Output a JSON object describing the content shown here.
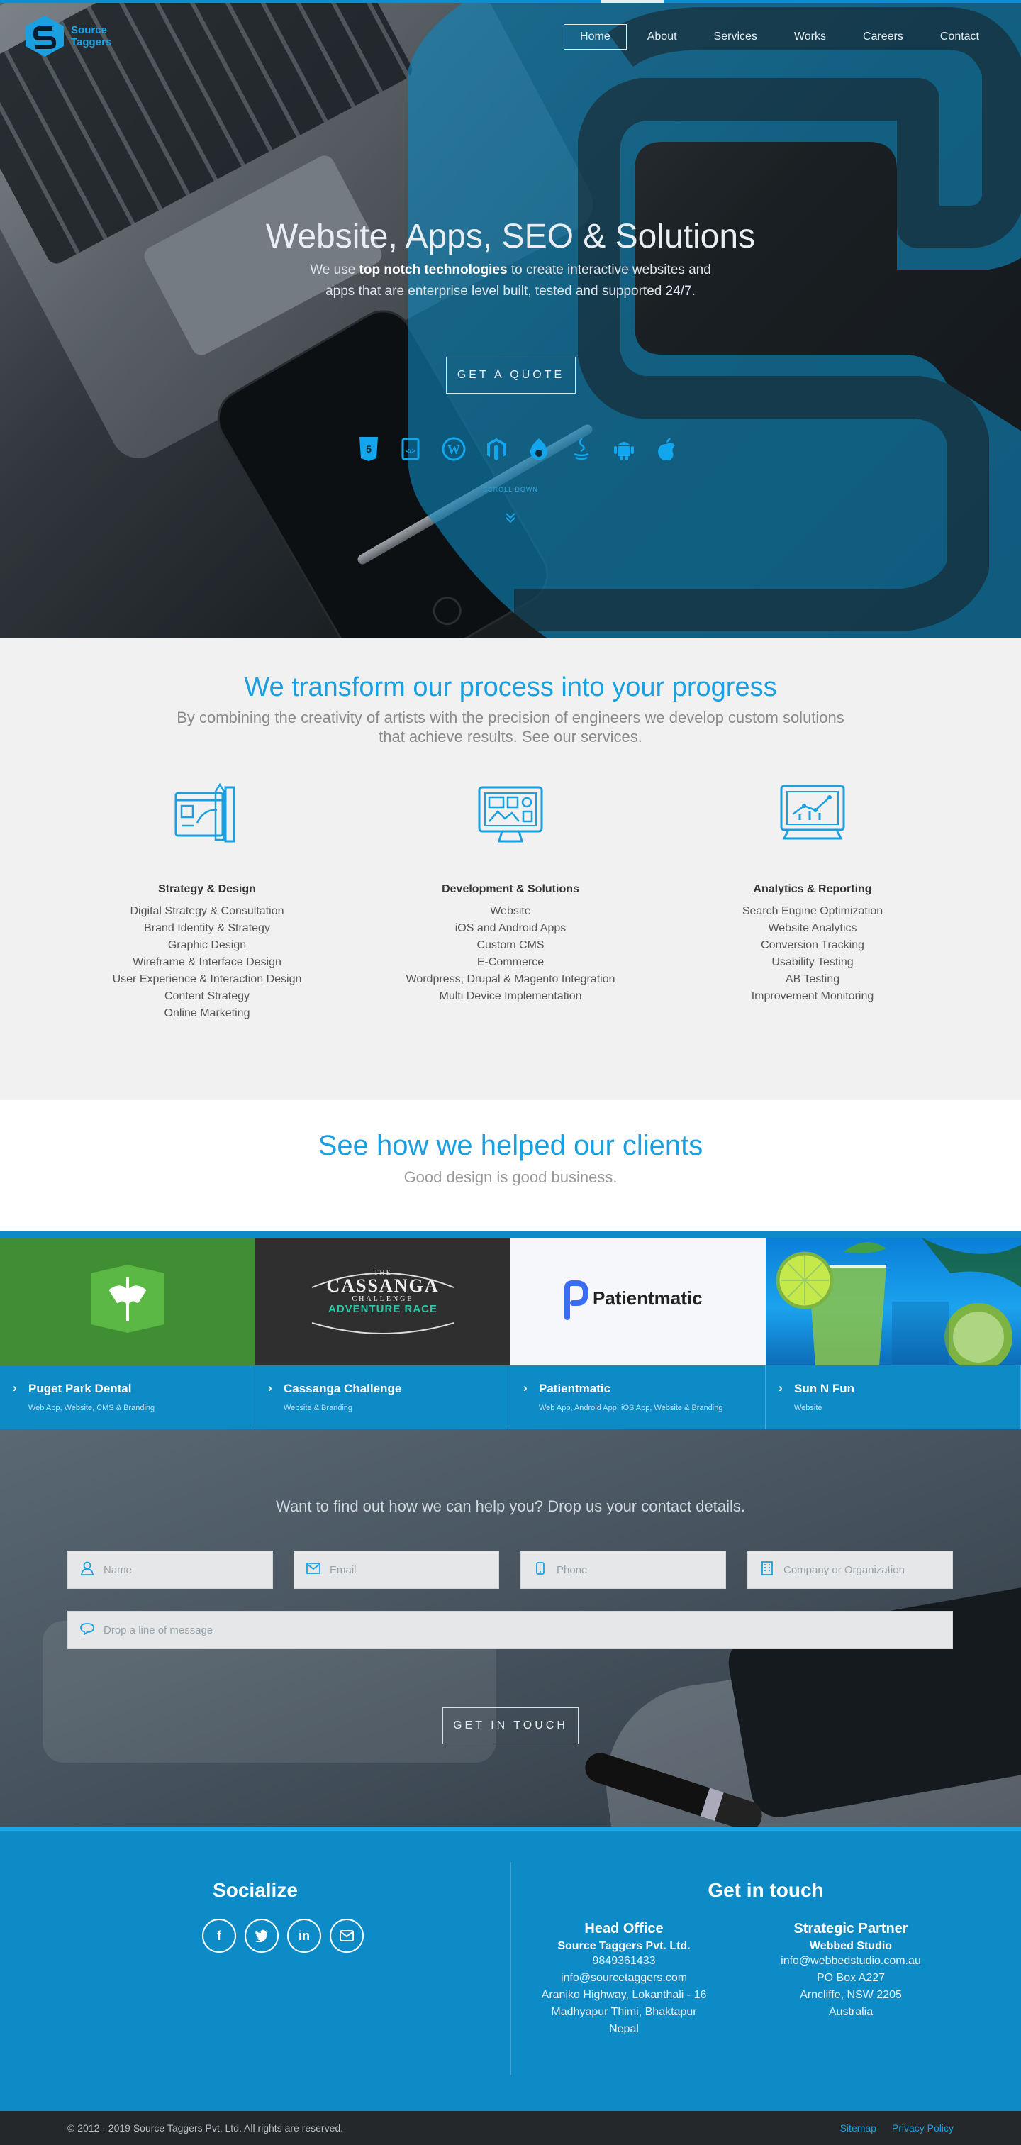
{
  "brand": {
    "name_line1": "Source",
    "name_line2": "Taggers",
    "accent": "#1aa0e0",
    "dark_blue": "#0c8bc7"
  },
  "nav": [
    {
      "label": "Home",
      "active": true
    },
    {
      "label": "About"
    },
    {
      "label": "Services"
    },
    {
      "label": "Works"
    },
    {
      "label": "Careers"
    },
    {
      "label": "Contact"
    }
  ],
  "hero": {
    "title": "Website, Apps, SEO & Solutions",
    "sub_before": "We use ",
    "sub_bold": "top notch technologies",
    "sub_after": " to create interactive websites and apps that are enterprise level built, tested and supported 24/7.",
    "cta": "GET A QUOTE",
    "tech_icons": [
      "html5-icon",
      "css-icon",
      "wordpress-icon",
      "magento-icon",
      "drupal-icon",
      "java-icon",
      "android-icon",
      "apple-icon"
    ],
    "scroll_label": "SCROLL DOWN"
  },
  "services": {
    "title": "We transform our process into your progress",
    "subtitle": "By combining the creativity of artists with the precision of engineers we develop custom solutions that achieve results. See our services.",
    "columns": [
      {
        "title": "Strategy & Design",
        "icon": "design-tools-icon",
        "items": [
          "Digital Strategy & Consultation",
          "Brand Identity & Strategy",
          "Graphic Design",
          "Wireframe & Interface Design",
          "User Experience & Interaction Design",
          "Content Strategy",
          "Online Marketing"
        ]
      },
      {
        "title": "Development & Solutions",
        "icon": "monitor-layout-icon",
        "items": [
          "Website",
          "iOS and Android Apps",
          "Custom CMS",
          "E-Commerce",
          "Wordpress, Drupal & Magento Integration",
          "Multi Device Implementation"
        ]
      },
      {
        "title": "Analytics & Reporting",
        "icon": "analytics-chart-icon",
        "items": [
          "Search Engine Optimization",
          "Website Analytics",
          "Conversion Tracking",
          "Usability Testing",
          "AB Testing",
          "Improvement Monitoring"
        ]
      }
    ]
  },
  "clients": {
    "title": "See how we helped our clients",
    "subtitle": "Good design is good business.",
    "works": [
      {
        "name": "Puget Park Dental",
        "tags": "Web App, Website, CMS & Branding"
      },
      {
        "name": "Cassanga Challenge",
        "tags": "Website & Branding",
        "logo_line1": "THE",
        "logo_line2": "CASSANGA",
        "logo_line3": "CHALLENGE",
        "logo_line4": "ADVENTURE RACE"
      },
      {
        "name": "Patientmatic",
        "tags": "Web App, Android App, iOS App, Website & Branding",
        "logo_text": "Patientmatic"
      },
      {
        "name": "Sun N Fun",
        "tags": "Website"
      }
    ]
  },
  "contact": {
    "title": "Want to find out how we can help you? Drop us your contact details.",
    "name_ph": "Name",
    "email_ph": "Email",
    "phone_ph": "Phone",
    "company_ph": "Company or Organization",
    "message_ph": "Drop a line of message",
    "submit": "GET IN TOUCH"
  },
  "footer": {
    "socialize": "Socialize",
    "social_icons": [
      "facebook-icon",
      "twitter-icon",
      "linkedin-icon",
      "mail-icon"
    ],
    "get_in_touch": "Get in touch",
    "head_office": {
      "title": "Head Office",
      "org": "Source Taggers Pvt. Ltd.",
      "lines": [
        "9849361433",
        "info@sourcetaggers.com",
        "Araniko Highway, Lokanthali - 16",
        "Madhyapur Thimi, Bhaktapur",
        "Nepal"
      ]
    },
    "partner": {
      "title": "Strategic Partner",
      "org": "Webbed Studio",
      "lines": [
        "info@webbedstudio.com.au",
        "PO Box A227",
        "Arncliffe, NSW 2205",
        "Australia"
      ]
    },
    "copyright": "© 2012 - 2019 Source Taggers Pvt. Ltd. All rights are reserved.",
    "links": [
      "Sitemap",
      "Privacy Policy"
    ]
  }
}
